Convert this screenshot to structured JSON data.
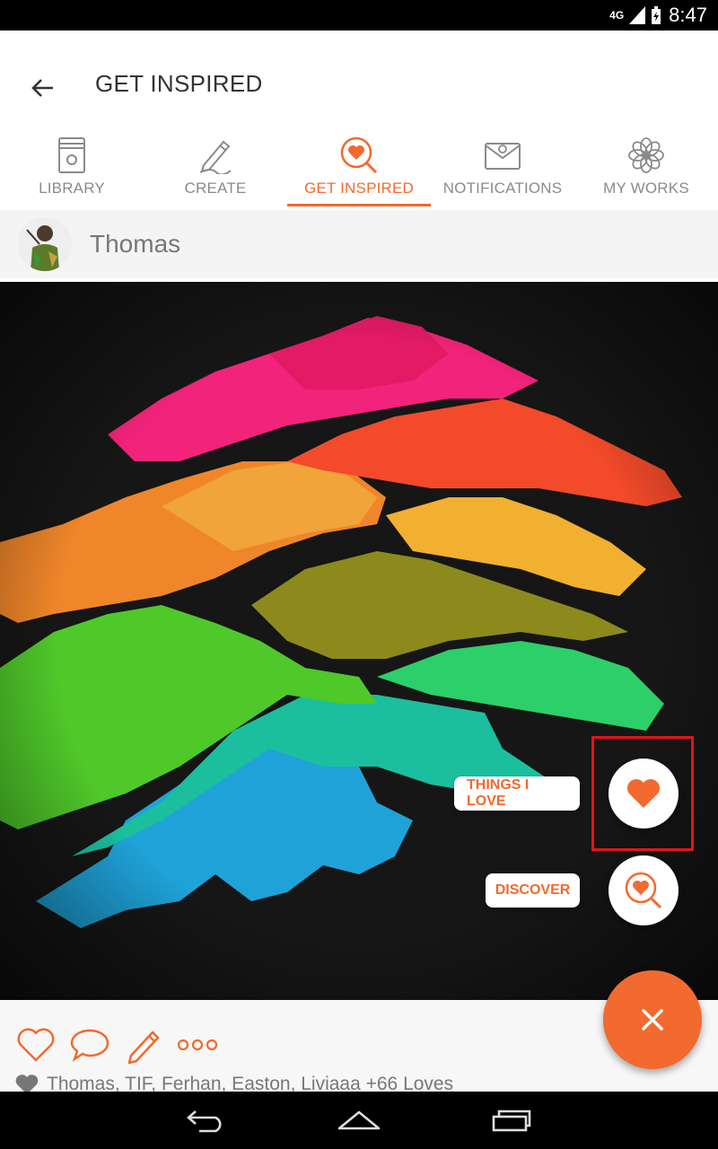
{
  "status_bar": {
    "network": "4G",
    "time": "8:47"
  },
  "app_bar": {
    "title": "GET INSPIRED",
    "back_icon": "arrow-left-icon"
  },
  "tabs": [
    {
      "label": "LIBRARY",
      "icon": "book-icon",
      "active": false
    },
    {
      "label": "CREATE",
      "icon": "pencil-icon",
      "active": false
    },
    {
      "label": "GET INSPIRED",
      "icon": "heart-search-icon",
      "active": true
    },
    {
      "label": "NOTIFICATIONS",
      "icon": "envelope-icon",
      "active": false
    },
    {
      "label": "MY WORKS",
      "icon": "flower-icon",
      "active": false
    }
  ],
  "post": {
    "author": "Thomas",
    "loves_text": "Thomas, TIF, Ferhan, Easton, Liviaaa +66 Loves"
  },
  "speed_dial": {
    "things_i_love": "THINGS I LOVE",
    "discover": "DISCOVER",
    "close_icon": "close-icon"
  },
  "actions": [
    {
      "name": "love-button",
      "icon": "heart-outline-icon"
    },
    {
      "name": "comment-button",
      "icon": "speech-bubble-icon"
    },
    {
      "name": "edit-button",
      "icon": "pencil-icon"
    },
    {
      "name": "more-button",
      "icon": "more-dots-icon"
    }
  ],
  "colors": {
    "accent": "#f26a2f",
    "highlight": "#e3141b",
    "artwork_bg": "#121312"
  }
}
